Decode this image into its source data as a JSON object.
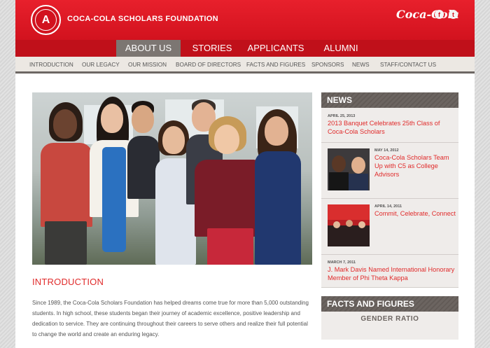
{
  "header": {
    "brand": "COCA-COLA SCHOLARS FOUNDATION",
    "seal_letter": "A",
    "coke_logo": "Coca-Cola",
    "social": [
      "f",
      "t"
    ]
  },
  "main_nav": [
    {
      "label": "ABOUT US",
      "active": true
    },
    {
      "label": "STORIES"
    },
    {
      "label": "APPLICANTS"
    },
    {
      "label": "ALUMNI"
    }
  ],
  "sub_nav": [
    "INTRODUCTION",
    "OUR LEGACY",
    "OUR MISSION",
    "BOARD OF DIRECTORS",
    "FACTS AND FIGURES",
    "SPONSORS",
    "NEWS",
    "STAFF/CONTACT US"
  ],
  "intro": {
    "title": "INTRODUCTION",
    "body": "Since 1989, the Coca-Cola Scholars Foundation has helped dreams come true for more than 5,000 outstanding students. In high school, these students began their journey of academic excellence, positive leadership and dedication to service. They are continuing throughout their careers to serve others and realize their full potential to change the world and create an enduring legacy."
  },
  "news": {
    "heading": "NEWS",
    "items": [
      {
        "date": "APRIL 25, 2013",
        "title": "2013 Banquet Celebrates 25th Class of Coca-Cola Scholars"
      },
      {
        "date": "MAY 14, 2012",
        "title": "Coca-Cola Scholars Team Up with C5 as College Advisors"
      },
      {
        "date": "APRIL 14, 2011",
        "title": "Commit, Celebrate, Connect"
      },
      {
        "date": "MARCH 7, 2011",
        "title": "J. Mark Davis Named International Honorary Member of Phi Theta Kappa"
      }
    ]
  },
  "facts": {
    "heading": "FACTS AND FIGURES",
    "subheading": "GENDER RATIO"
  },
  "colors": {
    "brand_red": "#e8202c",
    "nav_red": "#c0101a",
    "active_gray": "#7c7672",
    "sidebar_head": "#6c6561"
  }
}
